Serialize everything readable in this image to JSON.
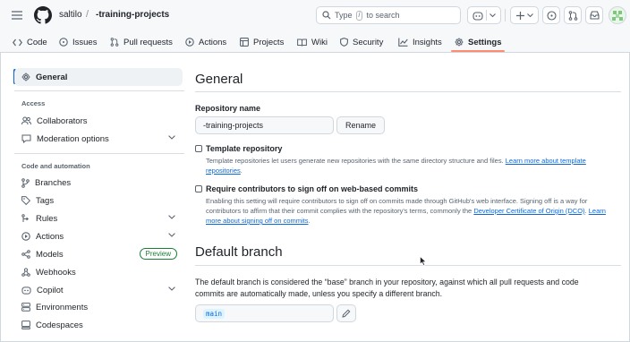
{
  "header": {
    "owner": "saltilo",
    "separator": "/",
    "repo": "-training-projects",
    "search": {
      "prefix": "Type",
      "key": "/",
      "suffix": "to search"
    },
    "icons": [
      "hamburger-icon",
      "github-logo-icon",
      "search-icon",
      "copilot-icon",
      "chevron-down-icon",
      "plus-icon",
      "issue-icon",
      "pull-request-icon",
      "inbox-icon",
      "avatar"
    ]
  },
  "repo_nav": {
    "tabs": [
      {
        "label": "Code",
        "icon": "code-icon"
      },
      {
        "label": "Issues",
        "icon": "issue-icon"
      },
      {
        "label": "Pull requests",
        "icon": "pull-request-icon"
      },
      {
        "label": "Actions",
        "icon": "play-icon"
      },
      {
        "label": "Projects",
        "icon": "table-icon"
      },
      {
        "label": "Wiki",
        "icon": "book-icon"
      },
      {
        "label": "Security",
        "icon": "shield-icon"
      },
      {
        "label": "Insights",
        "icon": "graph-icon"
      },
      {
        "label": "Settings",
        "icon": "gear-icon",
        "active": true
      }
    ]
  },
  "sidebar": {
    "general": "General",
    "access_heading": "Access",
    "collaborators": "Collaborators",
    "moderation": "Moderation options",
    "code_heading": "Code and automation",
    "items": [
      {
        "label": "Branches",
        "icon": "branch-icon"
      },
      {
        "label": "Tags",
        "icon": "tag-icon"
      },
      {
        "label": "Rules",
        "icon": "rules-icon"
      },
      {
        "label": "Actions",
        "icon": "play-icon"
      },
      {
        "label": "Models",
        "icon": "models-icon"
      },
      {
        "label": "Webhooks",
        "icon": "webhook-icon"
      },
      {
        "label": "Copilot",
        "icon": "copilot-icon"
      },
      {
        "label": "Environments",
        "icon": "server-icon"
      },
      {
        "label": "Codespaces",
        "icon": "codespaces-icon"
      }
    ],
    "preview_badge": "Preview"
  },
  "main": {
    "title": "General",
    "repo_name_label": "Repository name",
    "repo_name_value": "-training-projects",
    "rename_button": "Rename",
    "template": {
      "title": "Template repository",
      "desc": "Template repositories let users generate new repositories with the same directory structure and files.",
      "link": "Learn more about template repositories",
      "checked": false
    },
    "signoff": {
      "title": "Require contributors to sign off on web-based commits",
      "desc": "Enabling this setting will require contributors to sign off on commits made through GitHub's web interface. Signing off is a way for contributors to affirm that their commit complies with the repository's terms, commonly the",
      "link1": "Developer Certificate of Origin (DCO)",
      "link2": "Learn more about signing off on commits",
      "checked": false
    },
    "default_branch": {
      "title": "Default branch",
      "desc": "The default branch is considered the “base” branch in your repository, against which all pull requests and code commits are automatically made, unless you specify a different branch.",
      "value": "main"
    }
  },
  "colors": {
    "accent": "#0969da",
    "tab_underline": "#fd8c73",
    "preview_badge": "#1a7f37",
    "text": "#1f2328",
    "muted": "#59636e"
  }
}
